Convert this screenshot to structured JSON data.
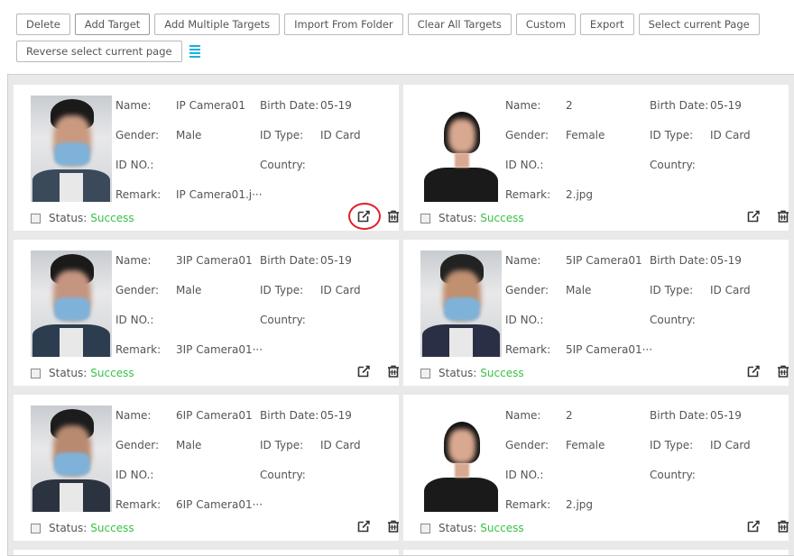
{
  "toolbar": {
    "buttons": [
      {
        "label": "Delete"
      },
      {
        "label": "Add Target"
      },
      {
        "label": "Add Multiple Targets"
      },
      {
        "label": "Import From Folder"
      },
      {
        "label": "Clear All Targets"
      },
      {
        "label": "Custom"
      },
      {
        "label": "Export"
      },
      {
        "label": "Select current Page"
      }
    ],
    "reverse_label": "Reverse select current page",
    "list_icon": "list-view-icon"
  },
  "labels": {
    "name": "Name:",
    "birth_date": "Birth Date:",
    "gender": "Gender:",
    "id_type": "ID Type:",
    "id_no": "ID NO.:",
    "country": "Country:",
    "remark": "Remark:",
    "status": "Status:"
  },
  "cards": [
    {
      "name": "IP Camera01",
      "birth_date": "05-19",
      "gender": "Male",
      "id_type": "ID Card",
      "id_no": "",
      "country": "",
      "remark": "IP Camera01.j···",
      "status": "Success"
    },
    {
      "name": "2",
      "birth_date": "05-19",
      "gender": "Female",
      "id_type": "ID Card",
      "id_no": "",
      "country": "",
      "remark": "2.jpg",
      "status": "Success"
    },
    {
      "name": "3IP Camera01",
      "birth_date": "05-19",
      "gender": "Male",
      "id_type": "ID Card",
      "id_no": "",
      "country": "",
      "remark": "3IP Camera01···",
      "status": "Success"
    },
    {
      "name": "5IP Camera01",
      "birth_date": "05-19",
      "gender": "Male",
      "id_type": "ID Card",
      "id_no": "",
      "country": "",
      "remark": "5IP Camera01···",
      "status": "Success"
    },
    {
      "name": "6IP Camera01",
      "birth_date": "05-19",
      "gender": "Male",
      "id_type": "ID Card",
      "id_no": "",
      "country": "",
      "remark": "6IP Camera01···",
      "status": "Success"
    },
    {
      "name": "2",
      "birth_date": "05-19",
      "gender": "Female",
      "id_type": "ID Card",
      "id_no": "",
      "country": "",
      "remark": "2.jpg",
      "status": "Success"
    }
  ],
  "colors": {
    "success": "#37c246",
    "accent": "#1ab0e0",
    "highlight": "#e0202a"
  },
  "icons": {
    "edit": "edit-icon",
    "delete": "trash-icon"
  }
}
